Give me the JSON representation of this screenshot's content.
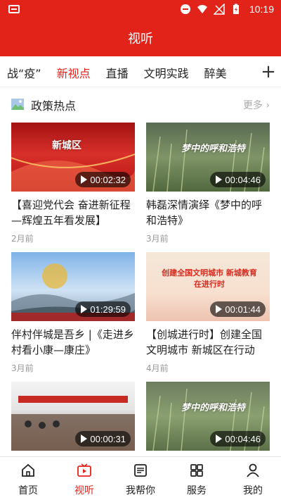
{
  "status_bar": {
    "time": "10:19"
  },
  "header": {
    "title": "视听"
  },
  "tabs": [
    {
      "label": "战“疫”"
    },
    {
      "label": "新视点"
    },
    {
      "label": "直播"
    },
    {
      "label": "文明实践"
    },
    {
      "label": "醉美"
    }
  ],
  "active_tab": "新视点",
  "tab_add_label": "+",
  "section": {
    "title": "政策热点",
    "more": "更多 ›"
  },
  "videos": [
    {
      "title": "【喜迎党代会 奋进新征程—辉煌五年看发展】",
      "duration": "00:02:32",
      "date": "2月前",
      "overlay": "新城区"
    },
    {
      "title": "韩磊深情演绎《梦中的呼和浩特》",
      "duration": "00:04:46",
      "date": "3月前",
      "overlay": "梦中的呼和浩特"
    },
    {
      "title": "伴村伴城是吾乡 |《走进乡村看小康—康庄》",
      "duration": "01:29:59",
      "date": "3月前",
      "overlay": ""
    },
    {
      "title": "【创城进行时】创建全国文明城市 新城区在行动",
      "duration": "00:01:44",
      "date": "4月前",
      "overlay": "创建全国文明城市 新城教育在进行时"
    },
    {
      "title": "",
      "duration": "00:00:31",
      "date": "",
      "overlay": ""
    },
    {
      "title": "",
      "duration": "00:04:46",
      "date": "",
      "overlay": "梦中的呼和浩特"
    }
  ],
  "bottom_nav": [
    {
      "label": "首页",
      "icon": "home-icon"
    },
    {
      "label": "视听",
      "icon": "video-icon"
    },
    {
      "label": "我帮你",
      "icon": "help-icon"
    },
    {
      "label": "服务",
      "icon": "grid-icon"
    },
    {
      "label": "我的",
      "icon": "user-icon"
    }
  ],
  "colors": {
    "brand": "#e2231a",
    "muted": "#999999"
  }
}
